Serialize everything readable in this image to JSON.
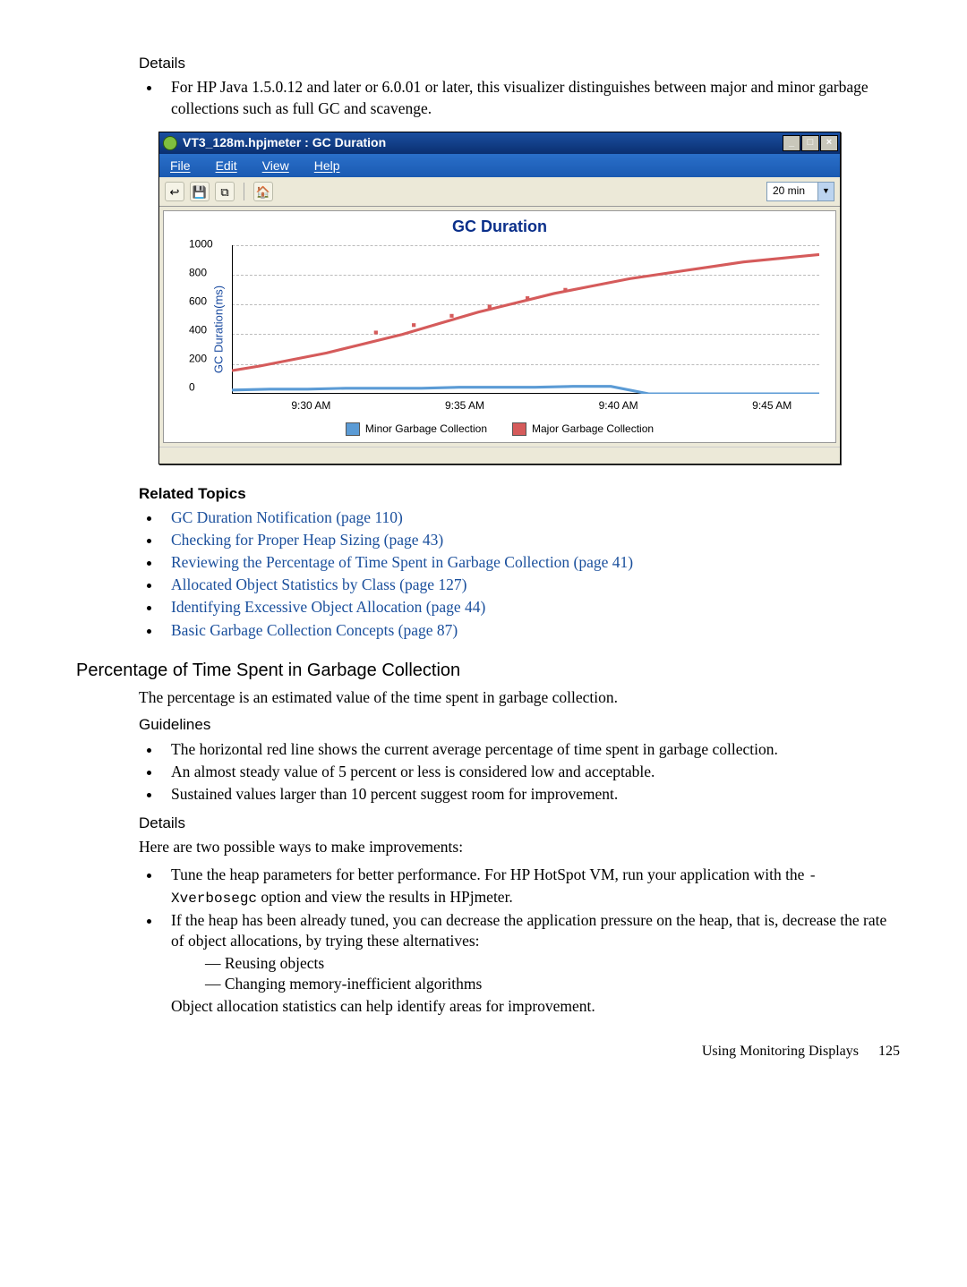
{
  "section1": {
    "details_heading": "Details",
    "details_bullet": "For HP Java 1.5.0.12 and later or 6.0.01 or later, this visualizer distinguishes between major and minor garbage collections such as full GC and scavenge."
  },
  "window": {
    "title": "VT3_128m.hpjmeter : GC Duration",
    "menu": {
      "file": "File",
      "edit": "Edit",
      "view": "View",
      "help": "Help"
    },
    "time_combo": "20 min",
    "chart_title": "GC Duration",
    "ylabel": "GC Duration(ms)",
    "yticks": [
      "1000",
      "800",
      "600",
      "400",
      "200",
      "0"
    ],
    "xticks": [
      "9:30 AM",
      "9:35 AM",
      "9:40 AM",
      "9:45 AM"
    ],
    "legend_minor": "Minor Garbage Collection",
    "legend_major": "Major Garbage Collection"
  },
  "chart_data": {
    "type": "line",
    "title": "GC Duration",
    "ylabel": "GC Duration(ms)",
    "xlabel": "",
    "ylim": [
      0,
      1000
    ],
    "categories": [
      "9:30 AM",
      "9:35 AM",
      "9:40 AM",
      "9:45 AM"
    ],
    "series": [
      {
        "name": "Minor Garbage Collection",
        "color": "#5b9bd5",
        "approx_values_ms": {
          "9:30 AM": 30,
          "9:35 AM": 35,
          "9:40 AM": 40,
          "9:45 AM": 30
        },
        "note": "stays near the x-axis, roughly 20–60 ms across the interval, drops to 0 after ~9:40"
      },
      {
        "name": "Major Garbage Collection",
        "color": "#d55b5b",
        "approx_values_ms": {
          "9:30 AM": 350,
          "9:35 AM": 680,
          "9:40 AM": 830,
          "9:45 AM": 900
        },
        "note": "rises from ~200 ms to ~950 ms"
      }
    ]
  },
  "related": {
    "heading": "Related Topics",
    "links": [
      "GC Duration Notification (page 110)",
      "Checking for Proper Heap Sizing (page 43)",
      "Reviewing the Percentage of Time Spent in Garbage Collection (page 41)",
      "Allocated Object Statistics by Class (page 127)",
      "Identifying Excessive Object Allocation (page 44)",
      "Basic Garbage Collection Concepts (page 87)"
    ]
  },
  "section2": {
    "heading": "Percentage of Time Spent in Garbage Collection",
    "intro": "The percentage is an estimated value of the time spent in garbage collection.",
    "guidelines_heading": "Guidelines",
    "guidelines": [
      "The horizontal red line shows the current average percentage of time spent in garbage collection.",
      "An almost steady value of 5 percent or less is considered low and acceptable.",
      "Sustained values larger than 10 percent suggest room for improvement."
    ],
    "details_heading": "Details",
    "details_intro": "Here are two possible ways to make improvements:",
    "det1_a": "Tune the heap parameters for better performance. For HP HotSpot VM, run your application with the ",
    "det1_code": "-Xverbosegc",
    "det1_b": " option and view the results in HPjmeter.",
    "det2": "If the heap has been already tuned, you can decrease the application pressure on the heap, that is, decrease the rate of object allocations, by trying these alternatives:",
    "det2_sub": [
      "Reusing objects",
      "Changing memory-inefficient algorithms"
    ],
    "det_close": "Object allocation statistics can help identify areas for improvement."
  },
  "footer": {
    "text": "Using Monitoring Displays",
    "page": "125"
  }
}
